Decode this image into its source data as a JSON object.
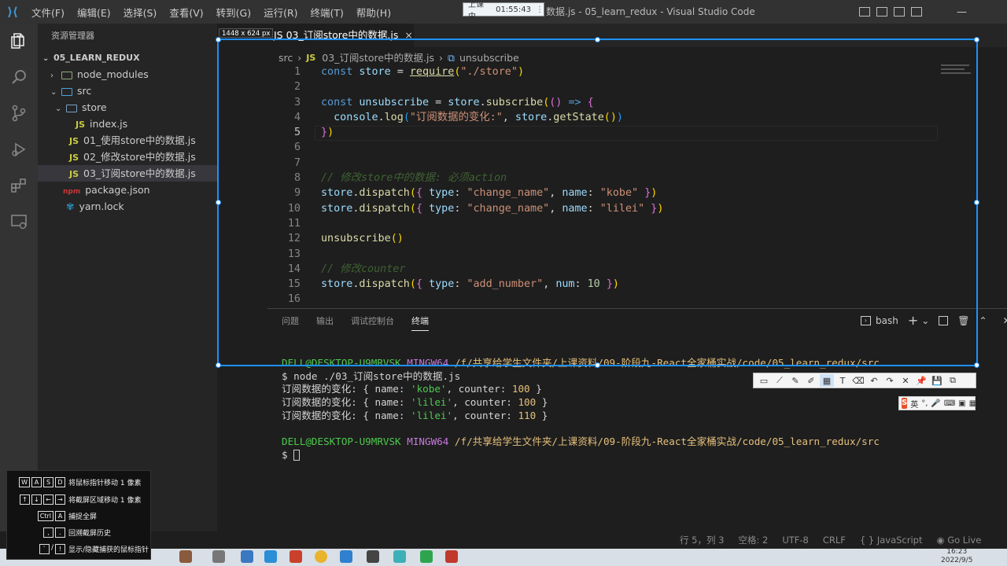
{
  "window": {
    "title": "03_订阅store中的数据.js - 05_learn_redux - Visual Studio Code",
    "title_visible": "数据.js - 05_learn_redux - Visual Studio Code",
    "menu": [
      "文件(F)",
      "编辑(E)",
      "选择(S)",
      "查看(V)",
      "转到(G)",
      "运行(R)",
      "终端(T)",
      "帮助(H)"
    ],
    "recording": {
      "label": "上课中",
      "time": "01:55:43"
    }
  },
  "sidebar": {
    "header": "资源管理器",
    "root": "05_LEARN_REDUX",
    "items": [
      {
        "label": "node_modules",
        "kind": "folder",
        "depth": 1,
        "expanded": false
      },
      {
        "label": "src",
        "kind": "folder",
        "depth": 1,
        "expanded": true
      },
      {
        "label": "store",
        "kind": "folder",
        "depth": 2,
        "expanded": true
      },
      {
        "label": "index.js",
        "kind": "js",
        "depth": 3
      },
      {
        "label": "01_使用store中的数据.js",
        "kind": "js",
        "depth": 2
      },
      {
        "label": "02_修改store中的数据.js",
        "kind": "js",
        "depth": 2
      },
      {
        "label": "03_订阅store中的数据.js",
        "kind": "js",
        "depth": 2,
        "selected": true
      },
      {
        "label": "package.json",
        "kind": "json",
        "depth": 1
      },
      {
        "label": "yarn.lock",
        "kind": "yarn",
        "depth": 1
      }
    ]
  },
  "editor": {
    "tab": "03_订阅store中的数据.js",
    "tab_visible": "JS 03_订阅store中的数据.js",
    "breadcrumb": [
      "src",
      "03_订阅store中的数据.js",
      "unsubscribe"
    ],
    "current_line": 5,
    "line_numbers": [
      "1",
      "2",
      "3",
      "4",
      "5",
      "6",
      "7",
      "8",
      "9",
      "10",
      "11",
      "12",
      "13",
      "14",
      "15",
      "16"
    ]
  },
  "panel": {
    "tabs": [
      "问题",
      "输出",
      "调试控制台",
      "终端"
    ],
    "active_tab": "终端",
    "shell": "bash",
    "terminal": {
      "prompt_user": "DELL@DESKTOP-U9MRVSK",
      "prompt_env": "MINGW64",
      "prompt_path": "/f/共享给学生文件夹/上课资料/09-阶段九-React全家桶实战/code/05_learn_redux/src",
      "command": "$ node ./03_订阅store中的数据.js",
      "outputs": [
        {
          "prefix": "订阅数据的变化: { name: ",
          "name": "'kobe'",
          "mid": ", counter: ",
          "counter": "100",
          "suffix": " }"
        },
        {
          "prefix": "订阅数据的变化: { name: ",
          "name": "'lilei'",
          "mid": ", counter: ",
          "counter": "100",
          "suffix": " }"
        },
        {
          "prefix": "订阅数据的变化: { name: ",
          "name": "'lilei'",
          "mid": ", counter: ",
          "counter": "110",
          "suffix": " }"
        }
      ],
      "last_prompt": "$ "
    }
  },
  "statusbar": {
    "position": "行 5，列 3",
    "spaces": "空格: 2",
    "encoding": "UTF-8",
    "eol": "CRLF",
    "language": "{ } JavaScript",
    "golive": "Go Live"
  },
  "overlay": {
    "size_label": "1448 x 624  px",
    "hints": [
      {
        "keys": [
          "W",
          "A",
          "S",
          "D"
        ],
        "text": "将鼠标指针移动 1 像素"
      },
      {
        "keys": [
          "↑",
          "↓",
          "←",
          "→"
        ],
        "text": "将截屏区域移动 1 像素"
      },
      {
        "keys": [
          "Ctrl",
          "A"
        ],
        "text": "捕捉全屏"
      },
      {
        "keys": [
          ",",
          "."
        ],
        "text": "回溯截屏历史"
      },
      {
        "keys": [
          "`",
          "/",
          "!"
        ],
        "text": "显示/隐藏捕获的鼠标指针"
      }
    ],
    "ime_label": "英"
  },
  "taskbar": {
    "time": "16:23",
    "date": "2022/9/5"
  },
  "colors": {
    "accent": "#1e90ff",
    "keyword": "#569cd6",
    "string": "#ce9178",
    "function": "#dcdcaa",
    "variable": "#9cdcfe",
    "comment": "#6a9955"
  }
}
